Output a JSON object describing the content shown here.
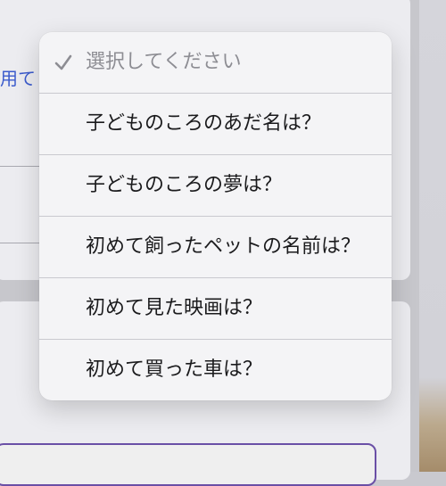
{
  "background": {
    "partial_text": "用て"
  },
  "dropdown": {
    "placeholder": "選択してください",
    "options": [
      {
        "label": "子どものころのあだ名は？"
      },
      {
        "label": "子どものころの夢は？"
      },
      {
        "label": "初めて飼ったペットの名前は？"
      },
      {
        "label": "初めて見た映画は？"
      },
      {
        "label": "初めて買った車は？"
      }
    ],
    "selected_index": 0
  },
  "colors": {
    "link": "#3b5bcc",
    "focus_border": "#6a4fa6",
    "placeholder_text": "#8d8d93"
  }
}
